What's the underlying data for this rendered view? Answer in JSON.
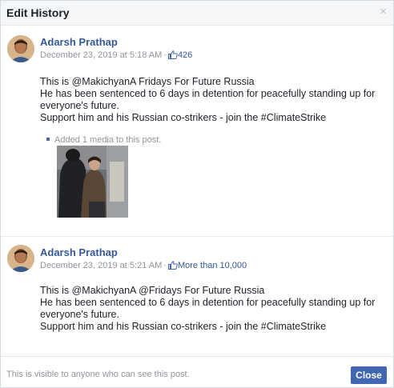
{
  "dialog": {
    "title": "Edit History",
    "close_glyph": "×"
  },
  "entries": [
    {
      "author": "Adarsh Prathap",
      "timestamp": "December 23, 2019 at 5:18 AM",
      "separator": "·",
      "likes": "426",
      "text_lines": [
        "This is @MakichyanA Fridays For Future Russia",
        "He has been sentenced to 6 days in detention for peacefully standing up for everyone's future.",
        "Support him and his Russian co-strikers - join the #ClimateStrike"
      ],
      "media_note": "Added 1 media to this post."
    },
    {
      "author": "Adarsh Prathap",
      "timestamp": "December 23, 2019 at 5:21 AM",
      "separator": "·",
      "likes": "More than 10,000",
      "text_lines": [
        "This is @MakichyanA @Fridays For Future Russia",
        "He has been sentenced to 6 days in detention for peacefully standing up for everyone's future.",
        "Support him and his Russian co-strikers - join the #ClimateStrike"
      ]
    }
  ],
  "footer": {
    "visibility_note": "This is visible to anyone who can see this post.",
    "close_label": "Close"
  },
  "colors": {
    "link": "#365899",
    "button": "#4267b2",
    "muted": "#90949c"
  }
}
